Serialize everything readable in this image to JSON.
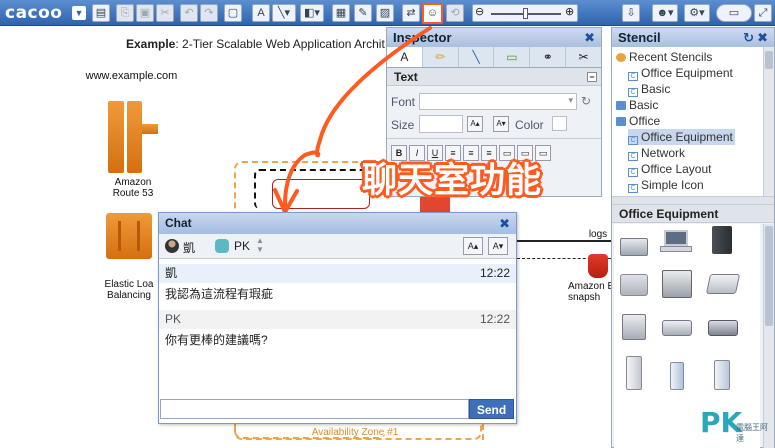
{
  "app": {
    "logo": "cacoo",
    "brand_color": "#2f63ad",
    "accent_color": "#ff5a1f"
  },
  "toolbar": {
    "icons": [
      "page-icon",
      "copy-icon",
      "paste-icon",
      "cut-icon",
      "undo-icon",
      "redo-icon",
      "delete-icon",
      "frame-icon",
      "text-icon",
      "connector-icon",
      "shape-icon",
      "table-icon",
      "pencil-icon",
      "image-icon",
      "share-icon",
      "chat-icon",
      "history-icon",
      "zoom-out-icon",
      "zoom-in-icon",
      "export-icon",
      "user-icon",
      "present-icon"
    ],
    "zoom_level": 0.65
  },
  "canvas": {
    "title_bold": "Example",
    "title_rest": ": 2-Tier Scalable Web Application Archit",
    "domain_label": "www.example.com",
    "route53_label": "Amazon\nRoute 53",
    "elb_label": "Elastic Loa\nBalancing",
    "logs_label": "logs",
    "snapshot_label": "Amazon E\nsnapsh",
    "az_label": "Availability Zone #1"
  },
  "annotation": {
    "text": "聊天室功能"
  },
  "inspector": {
    "title": "Inspector",
    "close": "✖",
    "tabs": [
      "A",
      "✏",
      "╲",
      "▭",
      "⚭",
      "✂"
    ],
    "section_text": "Text",
    "font_label": "Font",
    "size_label": "Size",
    "color_label": "Color",
    "font_value": "",
    "size_value": "",
    "style_buttons": [
      "B",
      "I",
      "U",
      "≡",
      "≡",
      "≡",
      "▭",
      "▭",
      "▭"
    ]
  },
  "stencil": {
    "title": "Stencil",
    "tree": [
      {
        "label": "Recent Stencils",
        "kind": "group"
      },
      {
        "label": "Office Equipment",
        "kind": "file"
      },
      {
        "label": "Basic",
        "kind": "file"
      },
      {
        "label": "Basic",
        "kind": "folder"
      },
      {
        "label": "Office",
        "kind": "folder"
      },
      {
        "label": "Office Equipment",
        "kind": "file",
        "selected": true
      },
      {
        "label": "Network",
        "kind": "file"
      },
      {
        "label": "Office Layout",
        "kind": "file"
      },
      {
        "label": "Simple Icon",
        "kind": "file"
      }
    ],
    "gallery_title": "Office Equipment"
  },
  "chat": {
    "title": "Chat",
    "close": "✖",
    "users": [
      {
        "name": "凱",
        "avatar": "person-photo"
      },
      {
        "name": "PK",
        "avatar": "robot-icon"
      }
    ],
    "messages": [
      {
        "author": "凱",
        "time": "12:22",
        "text": "我認為這流程有瑕疵"
      },
      {
        "author": "PK",
        "time": "12:22",
        "text": "你有更棒的建議嗎?"
      }
    ],
    "input_placeholder": "",
    "send_label": "Send"
  },
  "watermark": {
    "text": "PK",
    "sub": "電腦王阿達"
  }
}
